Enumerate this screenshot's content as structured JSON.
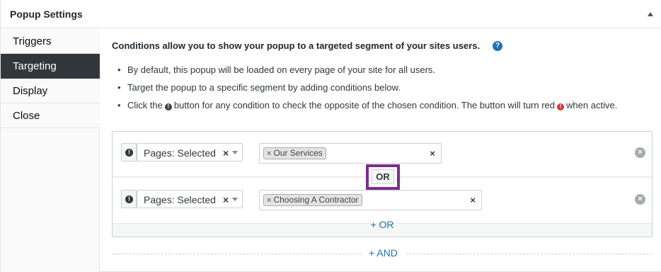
{
  "panel": {
    "title": "Popup Settings"
  },
  "sidebar": {
    "tabs": [
      {
        "label": "Triggers",
        "active": false
      },
      {
        "label": "Targeting",
        "active": true
      },
      {
        "label": "Display",
        "active": false
      },
      {
        "label": "Close",
        "active": false
      }
    ]
  },
  "content": {
    "intro": "Conditions allow you to show your popup to a targeted segment of your sites users.",
    "help_icon": "?",
    "bullets": {
      "b1": "By default, this popup will be loaded on every page of your site for all users.",
      "b2": "Target the popup to a specific segment by adding conditions below.",
      "b3_part1": "Click the",
      "b3_part2": "button for any condition to check the opposite of the chosen condition. The button will turn red",
      "b3_part3": "when active."
    }
  },
  "conditions": {
    "rows": [
      {
        "select_value": "Pages: Selected",
        "tags": [
          "Our Services"
        ]
      },
      {
        "select_value": "Pages: Selected",
        "tags": [
          "Choosing A Contractor"
        ]
      }
    ],
    "or_label": "OR",
    "add_or_label": "+ OR",
    "add_and_label": "+ AND"
  },
  "colors": {
    "active_tab_bg": "#32373c",
    "link_blue": "#2271b1",
    "highlight_purple": "#7b2e8e",
    "not_active_red": "#d63638"
  },
  "icons": {
    "not_operator": "exclamation-circle-icon",
    "remove_condition": "x-circle-icon",
    "collapse": "triangle-up-icon"
  }
}
